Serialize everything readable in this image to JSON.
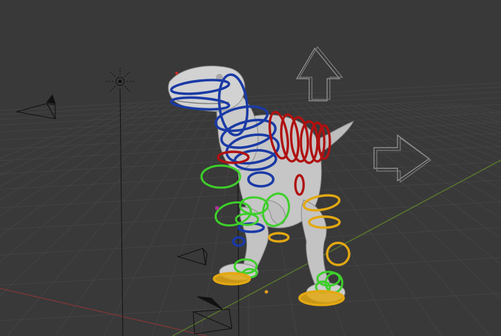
{
  "viewport": {
    "background": "#393939",
    "grid_color": "#444444",
    "x_axis_color": "#8a3a3a",
    "y_axis_color": "#5c7a2e"
  },
  "colors": {
    "mesh": "#c9c9c9",
    "mesh_shadow": "#8f8f8f",
    "head_spine_controls": "#1a3aa6",
    "back_tail_controls": "#b01010",
    "left_side_controls": "#3ecf2a",
    "right_side_controls": "#e3a812",
    "empty_gizmo": "#bdbdbd"
  },
  "icons": {
    "light": "sun-light-icon",
    "camera": "camera-object-icon",
    "up_arrow": "up-arrow-empty-icon",
    "right_arrow": "right-arrow-empty-icon",
    "origin": "object-origin-dot"
  }
}
